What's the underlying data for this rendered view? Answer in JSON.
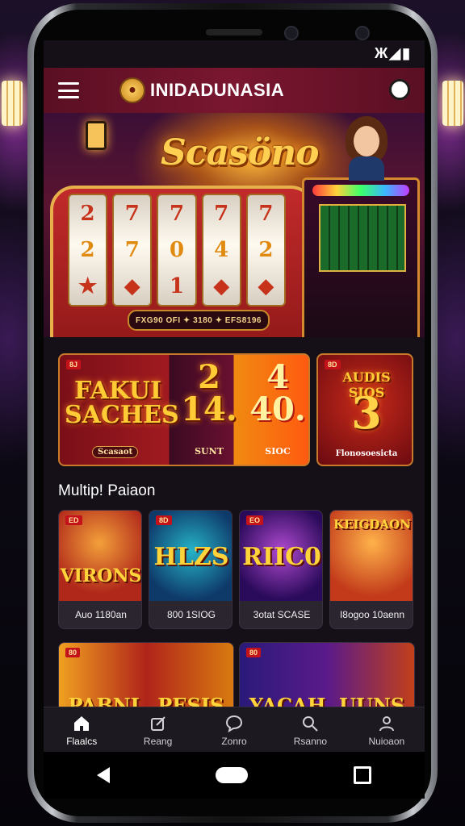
{
  "status_bar": {
    "icons": "Ж◢▮"
  },
  "app_bar": {
    "brand_name": "INIDADUNASIA",
    "brand_logo_glyph": "●",
    "brand_color": "#7a1630"
  },
  "hero": {
    "title": "Scasöno",
    "reels": [
      [
        "2",
        "2",
        "★"
      ],
      [
        "7",
        "7",
        "◆"
      ],
      [
        "7",
        "0",
        "1"
      ],
      [
        "7",
        "4",
        "◆"
      ],
      [
        "7",
        "2",
        "◆"
      ]
    ],
    "coin_line": "FXG90 OFI ✦ 3180 ✦ EFS8196"
  },
  "promos": [
    {
      "badge": "8J",
      "title": "FAKUI SACHES",
      "subtitle": "Scasaot",
      "num1": "2\n14.",
      "cap1": "SUNT",
      "num2": "4\n40.",
      "cap2": "SIOC"
    },
    {
      "badge": "8D",
      "title": "AUDIS SIOS",
      "num": "3",
      "caption": "Flonosoesicta"
    }
  ],
  "section": {
    "title": "Multip! Paiaon"
  },
  "games": [
    {
      "badge": "ED",
      "thumb_title": "VIRONS",
      "label": "Auo 1180an"
    },
    {
      "badge": "8D",
      "thumb_title": "HLZS",
      "label": "800 1SIOG"
    },
    {
      "badge": "EO",
      "thumb_title": "RIIC0",
      "label": "3otat SCASE"
    },
    {
      "badge": "",
      "thumb_title": "KEIGDAON",
      "label": "I8ogoo 10aenn"
    }
  ],
  "row2": [
    {
      "badge": "80",
      "title": "PABNL  PESIS"
    },
    {
      "badge": "80",
      "title": "YACAH  UUNS"
    }
  ],
  "bottom_nav": [
    {
      "label": "Flaalcs",
      "icon": "home-icon",
      "active": true
    },
    {
      "label": "Reang",
      "icon": "edit-icon",
      "active": false
    },
    {
      "label": "Zonro",
      "icon": "chat-icon",
      "active": false
    },
    {
      "label": "Rsanno",
      "icon": "search-icon",
      "active": false
    },
    {
      "label": "Nuioaon",
      "icon": "user-icon",
      "active": false
    }
  ]
}
